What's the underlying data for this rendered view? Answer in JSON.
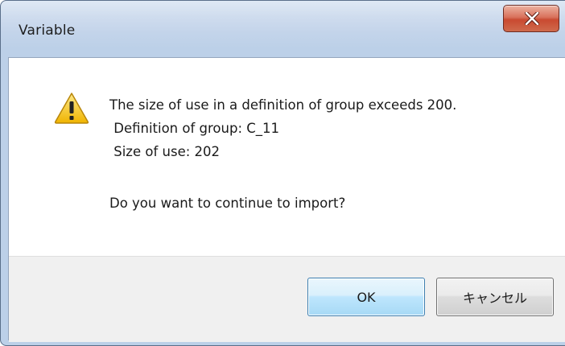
{
  "window": {
    "title": "Variable"
  },
  "icons": {
    "close": "close-icon",
    "warning": "warning-icon"
  },
  "message": {
    "line1": "The size of use in a definition of group exceeds 200.",
    "line2": " Definition of group: C_11",
    "line3": " Size of use: 202",
    "question": "Do you want to continue to import?"
  },
  "buttons": {
    "ok_label": "OK",
    "cancel_label": "キャンセル"
  },
  "colors": {
    "close_button": "#c94a31",
    "ok_border": "#3c7fb1",
    "warning_fill": "#f5c31c"
  }
}
